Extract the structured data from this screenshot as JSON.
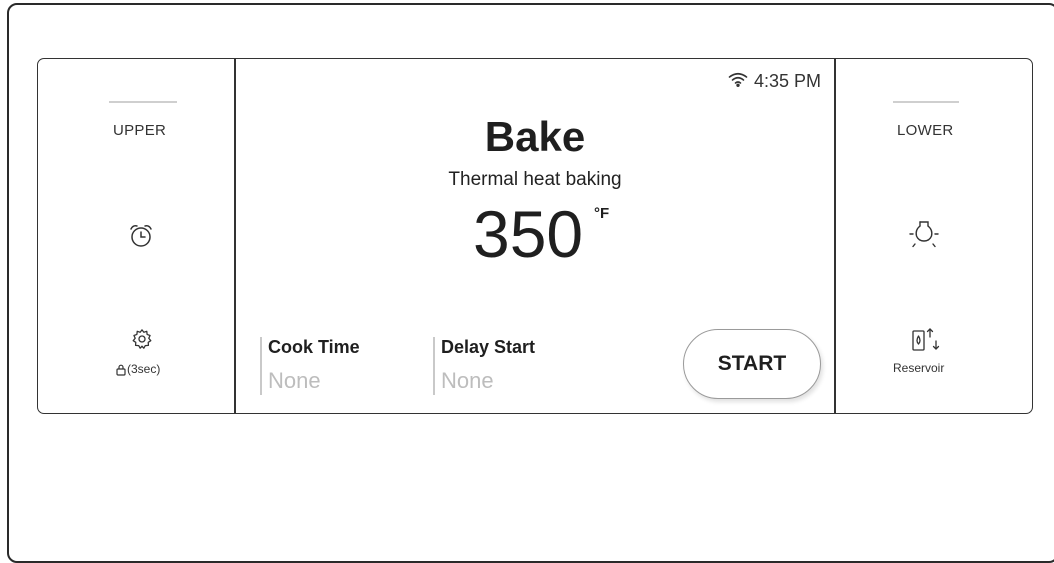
{
  "upper": {
    "label": "UPPER",
    "lock_label": "(3sec)",
    "icons": [
      "alarm-clock-icon",
      "gear-icon",
      "lock-icon"
    ]
  },
  "lower": {
    "label": "LOWER",
    "reservoir_label": "Reservoir",
    "icons": [
      "oven-light-icon",
      "reservoir-icon"
    ]
  },
  "status": {
    "time": "4:35 PM",
    "icon": "wifi-icon"
  },
  "mode": {
    "title": "Bake",
    "subtitle": "Thermal heat baking",
    "temperature": "350",
    "unit": "°F"
  },
  "cook_time": {
    "label": "Cook Time",
    "value": "None"
  },
  "delay_start": {
    "label": "Delay Start",
    "value": "None"
  },
  "start_button": {
    "label": "START"
  },
  "colors": {
    "border": "#333333",
    "placeholder": "#bdbdbd",
    "separator": "#cfcfcf"
  }
}
